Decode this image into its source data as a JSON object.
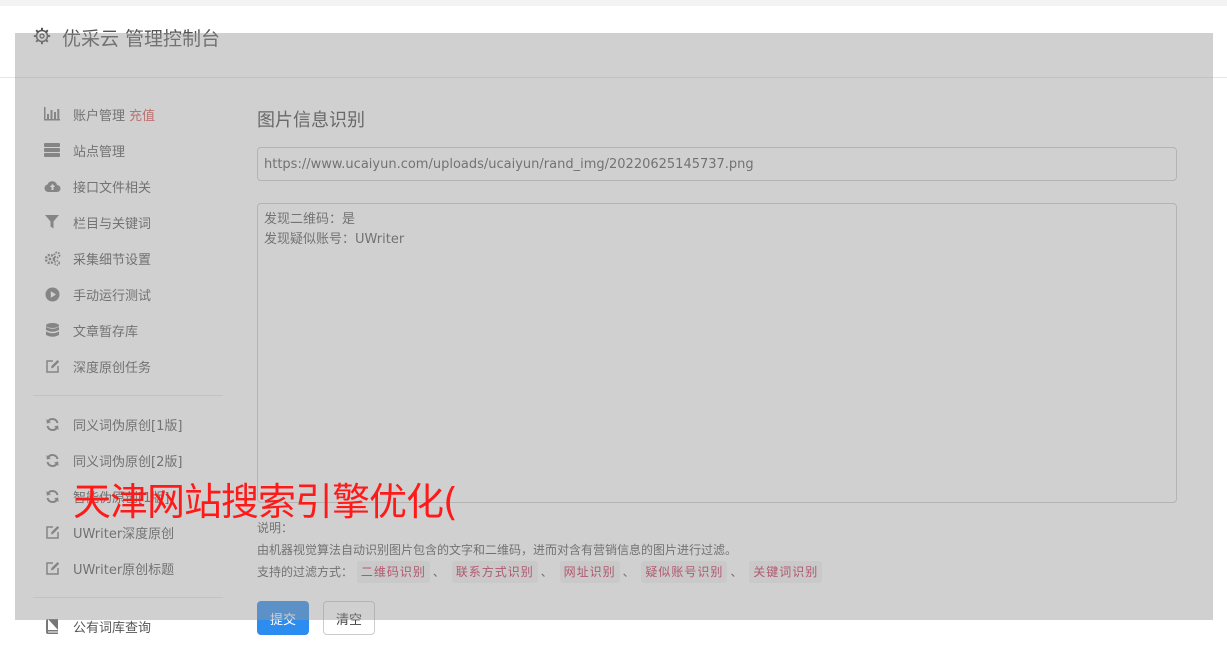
{
  "header": {
    "title": "优采云 管理控制台",
    "icon": "gear-icon"
  },
  "sidebar": {
    "group1": [
      {
        "label": "账户管理",
        "tag": "充值",
        "icon": "bar-chart-icon"
      },
      {
        "label": "站点管理",
        "icon": "server-icon"
      },
      {
        "label": "接口文件相关",
        "icon": "cloud-upload-icon"
      },
      {
        "label": "栏目与关键词",
        "icon": "filter-icon"
      },
      {
        "label": "采集细节设置",
        "icon": "cogs-icon"
      },
      {
        "label": "手动运行测试",
        "icon": "play-circle-icon"
      },
      {
        "label": "文章暂存库",
        "icon": "database-icon"
      },
      {
        "label": "深度原创任务",
        "icon": "edit-icon"
      }
    ],
    "group2": [
      {
        "label": "同义词伪原创[1版]",
        "icon": "refresh-icon"
      },
      {
        "label": "同义词伪原创[2版]",
        "icon": "refresh-icon"
      },
      {
        "label": "智能伪原创[1版]",
        "icon": "refresh-icon"
      },
      {
        "label": "UWriter深度原创",
        "icon": "edit-icon"
      },
      {
        "label": "UWriter原创标题",
        "icon": "edit-icon"
      }
    ],
    "group3": [
      {
        "label": "公有词库查询",
        "icon": "book-icon"
      }
    ]
  },
  "main": {
    "title": "图片信息识别",
    "url_value": "https://www.ucaiyun.com/uploads/ucaiyun/rand_img/20220625145737.png",
    "result_lines": [
      "发现二维码：是",
      "发现疑似账号：UWriter"
    ],
    "note_title": "说明：",
    "note_desc": "由机器视觉算法自动识别图片包含的文字和二维码，进而对含有营销信息的图片进行过滤。",
    "filter_label": "支持的过滤方式：",
    "filters": [
      "二维码识别",
      "联系方式识别",
      "网址识别",
      "疑似账号识别",
      "关键词识别"
    ],
    "separator": "、",
    "submit_label": "提交",
    "clear_label": "清空"
  },
  "watermark": "天津网站搜索引擎优化(",
  "colors": {
    "primary": "#2d8cf0",
    "tag_red": "#d9534f",
    "chip_text": "#c7254e",
    "watermark": "#ff1a1a"
  }
}
